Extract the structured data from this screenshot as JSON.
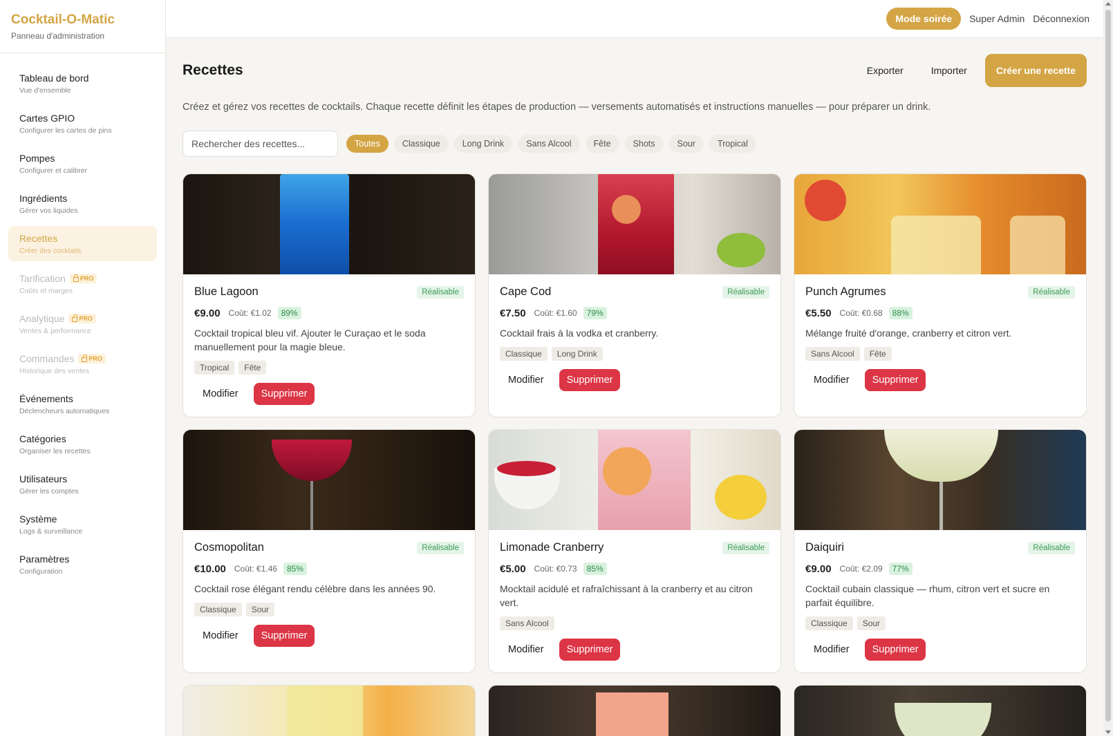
{
  "brand": {
    "title": "Cocktail-O-Matic",
    "subtitle": "Panneau d'administration"
  },
  "sidebar": {
    "items": [
      {
        "label": "Tableau de bord",
        "sub": "Vue d'ensemble"
      },
      {
        "label": "Cartes GPIO",
        "sub": "Configurer les cartes de pins"
      },
      {
        "label": "Pompes",
        "sub": "Configurer et calibrer"
      },
      {
        "label": "Ingrédients",
        "sub": "Gérer vos liquides"
      },
      {
        "label": "Recettes",
        "sub": "Créer des cocktails"
      },
      {
        "label": "Tarification",
        "sub": "Coûts et marges",
        "badge": "PRO"
      },
      {
        "label": "Analytique",
        "sub": "Ventes & performance",
        "badge": "PRO"
      },
      {
        "label": "Commandes",
        "sub": "Historique des ventes",
        "badge": "PRO"
      },
      {
        "label": "Événements",
        "sub": "Déclencheurs automatiques"
      },
      {
        "label": "Catégories",
        "sub": "Organiser les recettes"
      },
      {
        "label": "Utilisateurs",
        "sub": "Gérer les comptes"
      },
      {
        "label": "Système",
        "sub": "Logs & surveillance"
      },
      {
        "label": "Paramètres",
        "sub": "Configuration"
      }
    ]
  },
  "topbar": {
    "mode_label": "Mode soirée",
    "user": "Super Admin",
    "logout": "Déconnexion"
  },
  "page": {
    "title": "Recettes",
    "export_label": "Exporter",
    "import_label": "Importer",
    "create_label": "Créer une recette",
    "description": "Créez et gérez vos recettes de cocktails. Chaque recette définit les étapes de production — versements automatisés et instructions manuelles — pour préparer un drink."
  },
  "search": {
    "placeholder": "Rechercher des recettes..."
  },
  "filters": [
    "Toutes",
    "Classique",
    "Long Drink",
    "Sans Alcool",
    "Fête",
    "Shots",
    "Sour",
    "Tropical"
  ],
  "card_labels": {
    "edit": "Modifier",
    "delete": "Supprimer",
    "cost_prefix": "Coût: "
  },
  "recipes": [
    {
      "name": "Blue Lagoon",
      "status": "Réalisable",
      "price": "€9.00",
      "cost": "€1.02",
      "margin": "89%",
      "desc": "Cocktail tropical bleu vif. Ajouter le Curaçao et le soda manuellement pour la magie bleue.",
      "tags": [
        "Tropical",
        "Fête"
      ]
    },
    {
      "name": "Cape Cod",
      "status": "Réalisable",
      "price": "€7.50",
      "cost": "€1.60",
      "margin": "79%",
      "desc": "Cocktail frais à la vodka et cranberry.",
      "tags": [
        "Classique",
        "Long Drink"
      ]
    },
    {
      "name": "Punch Agrumes",
      "status": "Réalisable",
      "price": "€5.50",
      "cost": "€0.68",
      "margin": "88%",
      "desc": "Mélange fruité d'orange, cranberry et citron vert.",
      "tags": [
        "Sans Alcool",
        "Fête"
      ]
    },
    {
      "name": "Cosmopolitan",
      "status": "Réalisable",
      "price": "€10.00",
      "cost": "€1.46",
      "margin": "85%",
      "desc": "Cocktail rose élégant rendu célèbre dans les années 90.",
      "tags": [
        "Classique",
        "Sour"
      ]
    },
    {
      "name": "Limonade Cranberry",
      "status": "Réalisable",
      "price": "€5.00",
      "cost": "€0.73",
      "margin": "85%",
      "desc": "Mocktail acidulé et rafraîchissant à la cranberry et au citron vert.",
      "tags": [
        "Sans Alcool"
      ]
    },
    {
      "name": "Daiquiri",
      "status": "Réalisable",
      "price": "€9.00",
      "cost": "€2.09",
      "margin": "77%",
      "desc": "Cocktail cubain classique — rhum, citron vert et sucre en parfait équilibre.",
      "tags": [
        "Classique",
        "Sour"
      ]
    }
  ]
}
